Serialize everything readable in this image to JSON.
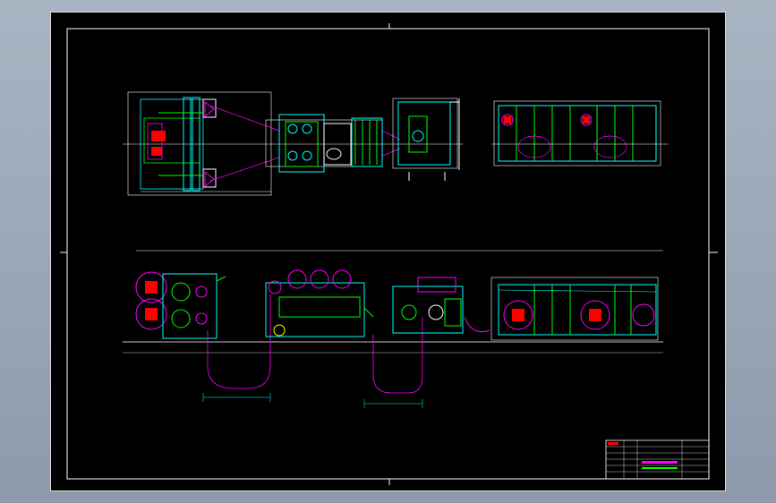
{
  "viewer": {
    "background": "#9aa6b6",
    "canvas_color": "#000000"
  },
  "drawing": {
    "colors": {
      "frame": "#ffffff",
      "outline": "#ffffff",
      "cyan": "#00ffff",
      "green": "#00ff00",
      "magenta": "#ff00ff",
      "red": "#ff0000",
      "yellow": "#ffff00",
      "blue": "#4060ff"
    },
    "views": [
      "top-view-left-unwind",
      "top-view-center-press",
      "top-view-right-unit",
      "front-view-production-line"
    ],
    "title_block": {
      "rows": 6,
      "columns": 6,
      "legible_text": []
    }
  }
}
